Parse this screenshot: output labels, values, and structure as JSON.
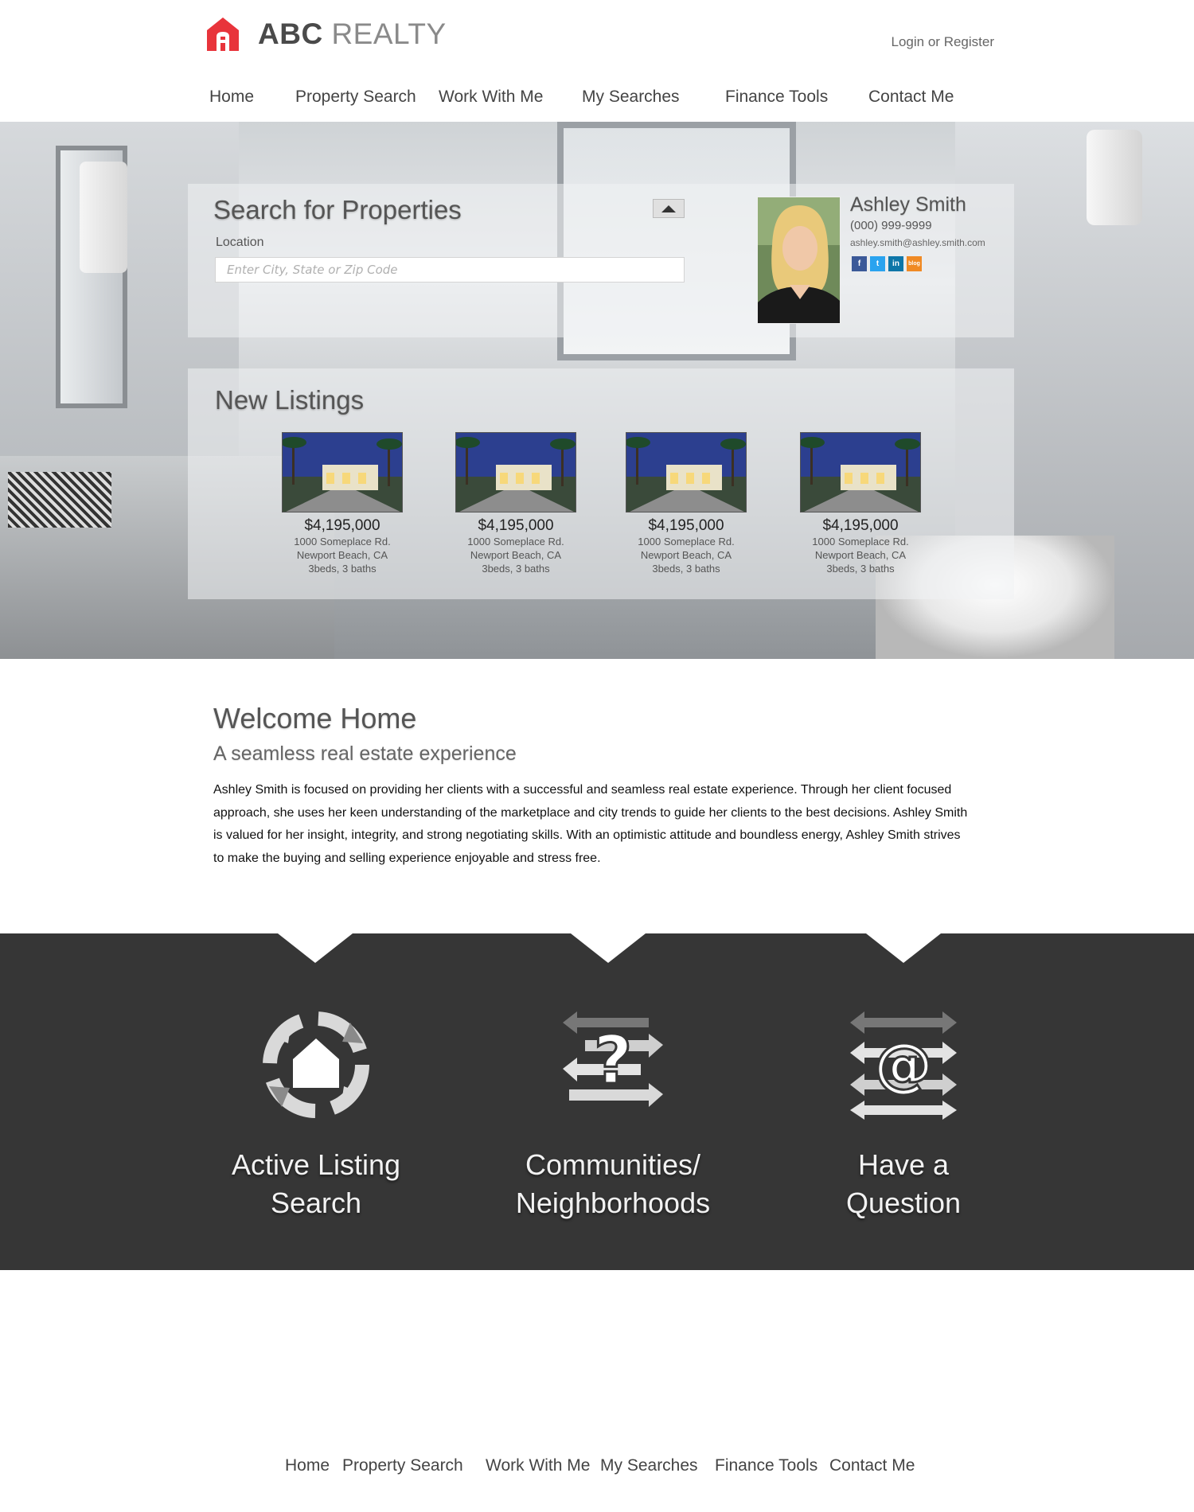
{
  "brand": {
    "abc": "ABC",
    "realty": "REALTY",
    "accent_color": "#e8343b"
  },
  "header": {
    "login": "Login",
    "or": "or",
    "register": "Register"
  },
  "nav": [
    "Home",
    "Property Search",
    "Work With Me",
    "My Searches",
    "Finance Tools",
    "Contact Me"
  ],
  "search": {
    "title": "Search for Properties",
    "location_label": "Location",
    "location_placeholder": "Enter City, State or Zip Code",
    "toggle_icon": "caret-up-icon"
  },
  "agent": {
    "name": "Ashley Smith",
    "phone": "(000) 999-9999",
    "email": "ashley.smith@ashley.smith.com",
    "social": [
      "facebook-icon",
      "twitter-icon",
      "linkedin-icon",
      "blog-icon"
    ]
  },
  "listings": {
    "title": "New Listings",
    "items": [
      {
        "price": "$4,195,000",
        "address": "1000 Someplace Rd.",
        "city": "Newport Beach, CA",
        "details": "3beds, 3 baths"
      },
      {
        "price": "$4,195,000",
        "address": "1000 Someplace Rd.",
        "city": "Newport Beach, CA",
        "details": "3beds, 3 baths"
      },
      {
        "price": "$4,195,000",
        "address": "1000 Someplace Rd.",
        "city": "Newport Beach, CA",
        "details": "3beds, 3 baths"
      },
      {
        "price": "$4,195,000",
        "address": "1000 Someplace Rd.",
        "city": "Newport Beach, CA",
        "details": "3beds, 3 baths"
      }
    ]
  },
  "welcome": {
    "title": "Welcome Home",
    "subtitle": "A seamless real estate experience",
    "body": "Ashley Smith is focused on providing her clients with a successful and seamless real estate experience. Through her client focused approach, she uses her keen understanding of the marketplace and city trends to guide her clients to the best decisions. Ashley Smith is valued for her insight, integrity, and strong negotiating skills. With an optimistic attitude and boundless energy, Ashley Smith strives to make the buying and selling experience enjoyable and stress free."
  },
  "features": [
    {
      "line1": "Active Listing",
      "line2": "Search",
      "icon": "house-cycle-icon"
    },
    {
      "line1": "Communities/",
      "line2": "Neighborhoods",
      "icon": "question-arrows-icon"
    },
    {
      "line1": "Have a",
      "line2": "Question",
      "icon": "at-arrows-icon"
    }
  ],
  "footer_nav": [
    "Home",
    "Property Search",
    "Work With Me",
    "My Searches",
    "Finance Tools",
    "Contact Me"
  ]
}
